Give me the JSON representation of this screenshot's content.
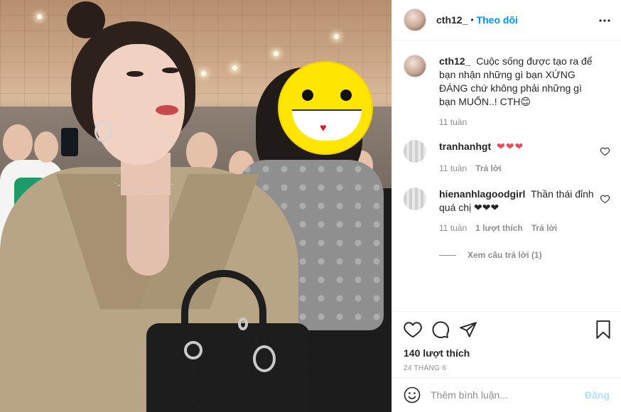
{
  "header": {
    "username": "cth12_",
    "separator": "•",
    "follow_label": "Theo dõi",
    "more_icon": "more-horizontal-icon"
  },
  "caption": {
    "username": "cth12_",
    "text": "Cuộc sống được tạo ra để bạn nhận những gì bạn XỨNG ĐÁNG chứ không phải những gì bạn MUỐN..! CTH😊",
    "time": "11 tuần"
  },
  "comments": [
    {
      "username": "tranhanhgt",
      "text": "❤❤❤",
      "time": "11 tuần",
      "reply_label": "Trả lời"
    },
    {
      "username": "hienanhlagoodgirl",
      "text": "Thần thái đỉnh quá chị ❤❤❤",
      "time": "11 tuần",
      "likes_label": "1 lượt thích",
      "reply_label": "Trả lời",
      "view_replies_label": "Xem câu trả lời (1)"
    }
  ],
  "actions": {
    "like_icon": "heart-icon",
    "comment_icon": "comment-icon",
    "share_icon": "send-icon",
    "save_icon": "bookmark-icon",
    "likes_text": "140 lượt thích",
    "date_text": "24 THÁNG 6"
  },
  "add_comment": {
    "placeholder": "Thêm bình luận...",
    "post_label": "Đăng",
    "emoji_icon": "smile-emoji-icon"
  },
  "colors": {
    "link_blue": "#0095f6",
    "post_disabled": "#b2dffc",
    "heart_red": "#ed4956",
    "smiley_yellow": "#ffe500"
  }
}
